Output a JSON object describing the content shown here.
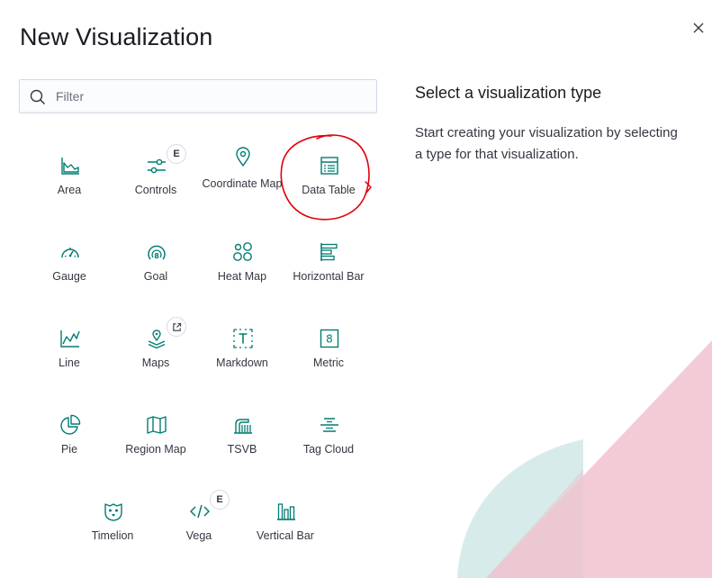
{
  "modal": {
    "title": "New Visualization",
    "close_icon": "close-icon"
  },
  "search": {
    "placeholder": "Filter",
    "value": "",
    "icon": "search-icon"
  },
  "side_panel": {
    "title": "Select a visualization type",
    "description": "Start creating your visualization by selecting a type for that visualization."
  },
  "visualizations": [
    {
      "label": "Area",
      "icon": "area-chart-icon"
    },
    {
      "label": "Controls",
      "icon": "controls-icon",
      "badge": "E"
    },
    {
      "label": "Coordinate Map",
      "icon": "map-marker-icon"
    },
    {
      "label": "Data Table",
      "icon": "table-icon",
      "annotated": true
    },
    {
      "label": "Gauge",
      "icon": "gauge-icon"
    },
    {
      "label": "Goal",
      "icon": "goal-icon"
    },
    {
      "label": "Heat Map",
      "icon": "heatmap-icon"
    },
    {
      "label": "Horizontal Bar",
      "icon": "horizontal-bar-icon"
    },
    {
      "label": "Line",
      "icon": "line-chart-icon"
    },
    {
      "label": "Maps",
      "icon": "maps-icon",
      "badge": "external-link-icon"
    },
    {
      "label": "Markdown",
      "icon": "markdown-icon"
    },
    {
      "label": "Metric",
      "icon": "metric-icon"
    },
    {
      "label": "Pie",
      "icon": "pie-chart-icon"
    },
    {
      "label": "Region Map",
      "icon": "region-map-icon"
    },
    {
      "label": "TSVB",
      "icon": "tsvb-icon"
    },
    {
      "label": "Tag Cloud",
      "icon": "tag-cloud-icon"
    },
    {
      "label": "Timelion",
      "icon": "timelion-icon"
    },
    {
      "label": "Vega",
      "icon": "vega-icon",
      "badge": "E"
    },
    {
      "label": "Vertical Bar",
      "icon": "vertical-bar-icon"
    }
  ],
  "colors": {
    "icon": "#017d73",
    "annotation": "#e0000a",
    "decor_pink": "#f3c8d4",
    "decor_teal": "#cfe8e3"
  }
}
